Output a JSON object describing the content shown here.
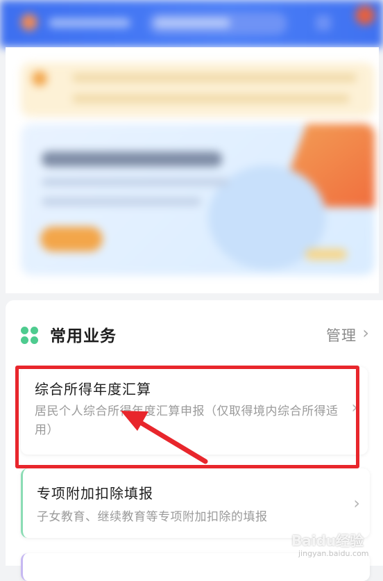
{
  "section": {
    "title": "常用业务",
    "manage_label": "管理",
    "manage_chevron": "›"
  },
  "services": [
    {
      "title": "综合所得年度汇算",
      "description": "居民个人综合所得年度汇算申报（仅取得境内综合所得适用）",
      "chevron": "›"
    },
    {
      "title": "专项附加扣除填报",
      "description": "子女教育、继续教育等专项附加扣除的填报",
      "chevron": "›"
    }
  ],
  "annotation": {
    "highlight_color": "#e8262c"
  },
  "watermark": {
    "brand": "Baidu经验",
    "url": "jingyan.baidu.com"
  },
  "colors": {
    "header_blue": "#4a7ef7",
    "grid_icon_green": "#4ecb8f",
    "card2_accent": "#8bdcb4",
    "card3_accent": "#c6b8f2"
  }
}
